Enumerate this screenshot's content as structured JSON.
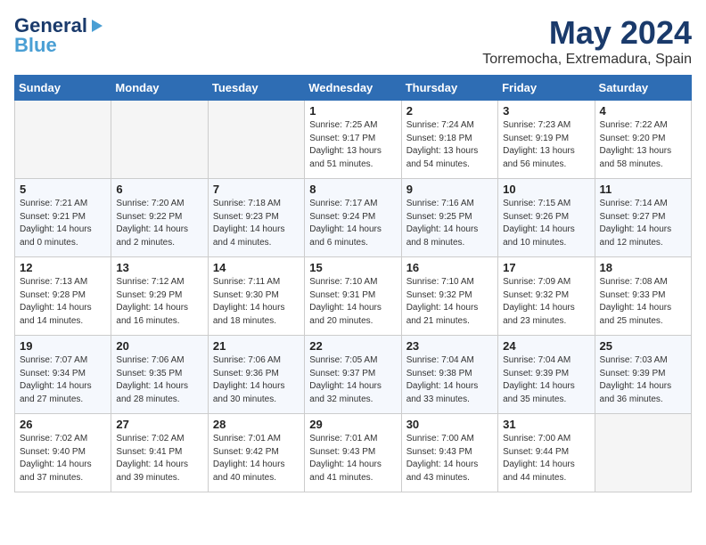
{
  "header": {
    "logo_general": "General",
    "logo_blue": "Blue",
    "month_title": "May 2024",
    "location": "Torremocha, Extremadura, Spain"
  },
  "days_of_week": [
    "Sunday",
    "Monday",
    "Tuesday",
    "Wednesday",
    "Thursday",
    "Friday",
    "Saturday"
  ],
  "weeks": [
    [
      {
        "day": "",
        "sunrise": "",
        "sunset": "",
        "daylight": "",
        "empty": true
      },
      {
        "day": "",
        "sunrise": "",
        "sunset": "",
        "daylight": "",
        "empty": true
      },
      {
        "day": "",
        "sunrise": "",
        "sunset": "",
        "daylight": "",
        "empty": true
      },
      {
        "day": "1",
        "sunrise": "Sunrise: 7:25 AM",
        "sunset": "Sunset: 9:17 PM",
        "daylight": "Daylight: 13 hours and 51 minutes.",
        "empty": false
      },
      {
        "day": "2",
        "sunrise": "Sunrise: 7:24 AM",
        "sunset": "Sunset: 9:18 PM",
        "daylight": "Daylight: 13 hours and 54 minutes.",
        "empty": false
      },
      {
        "day": "3",
        "sunrise": "Sunrise: 7:23 AM",
        "sunset": "Sunset: 9:19 PM",
        "daylight": "Daylight: 13 hours and 56 minutes.",
        "empty": false
      },
      {
        "day": "4",
        "sunrise": "Sunrise: 7:22 AM",
        "sunset": "Sunset: 9:20 PM",
        "daylight": "Daylight: 13 hours and 58 minutes.",
        "empty": false
      }
    ],
    [
      {
        "day": "5",
        "sunrise": "Sunrise: 7:21 AM",
        "sunset": "Sunset: 9:21 PM",
        "daylight": "Daylight: 14 hours and 0 minutes.",
        "empty": false
      },
      {
        "day": "6",
        "sunrise": "Sunrise: 7:20 AM",
        "sunset": "Sunset: 9:22 PM",
        "daylight": "Daylight: 14 hours and 2 minutes.",
        "empty": false
      },
      {
        "day": "7",
        "sunrise": "Sunrise: 7:18 AM",
        "sunset": "Sunset: 9:23 PM",
        "daylight": "Daylight: 14 hours and 4 minutes.",
        "empty": false
      },
      {
        "day": "8",
        "sunrise": "Sunrise: 7:17 AM",
        "sunset": "Sunset: 9:24 PM",
        "daylight": "Daylight: 14 hours and 6 minutes.",
        "empty": false
      },
      {
        "day": "9",
        "sunrise": "Sunrise: 7:16 AM",
        "sunset": "Sunset: 9:25 PM",
        "daylight": "Daylight: 14 hours and 8 minutes.",
        "empty": false
      },
      {
        "day": "10",
        "sunrise": "Sunrise: 7:15 AM",
        "sunset": "Sunset: 9:26 PM",
        "daylight": "Daylight: 14 hours and 10 minutes.",
        "empty": false
      },
      {
        "day": "11",
        "sunrise": "Sunrise: 7:14 AM",
        "sunset": "Sunset: 9:27 PM",
        "daylight": "Daylight: 14 hours and 12 minutes.",
        "empty": false
      }
    ],
    [
      {
        "day": "12",
        "sunrise": "Sunrise: 7:13 AM",
        "sunset": "Sunset: 9:28 PM",
        "daylight": "Daylight: 14 hours and 14 minutes.",
        "empty": false
      },
      {
        "day": "13",
        "sunrise": "Sunrise: 7:12 AM",
        "sunset": "Sunset: 9:29 PM",
        "daylight": "Daylight: 14 hours and 16 minutes.",
        "empty": false
      },
      {
        "day": "14",
        "sunrise": "Sunrise: 7:11 AM",
        "sunset": "Sunset: 9:30 PM",
        "daylight": "Daylight: 14 hours and 18 minutes.",
        "empty": false
      },
      {
        "day": "15",
        "sunrise": "Sunrise: 7:10 AM",
        "sunset": "Sunset: 9:31 PM",
        "daylight": "Daylight: 14 hours and 20 minutes.",
        "empty": false
      },
      {
        "day": "16",
        "sunrise": "Sunrise: 7:10 AM",
        "sunset": "Sunset: 9:32 PM",
        "daylight": "Daylight: 14 hours and 21 minutes.",
        "empty": false
      },
      {
        "day": "17",
        "sunrise": "Sunrise: 7:09 AM",
        "sunset": "Sunset: 9:32 PM",
        "daylight": "Daylight: 14 hours and 23 minutes.",
        "empty": false
      },
      {
        "day": "18",
        "sunrise": "Sunrise: 7:08 AM",
        "sunset": "Sunset: 9:33 PM",
        "daylight": "Daylight: 14 hours and 25 minutes.",
        "empty": false
      }
    ],
    [
      {
        "day": "19",
        "sunrise": "Sunrise: 7:07 AM",
        "sunset": "Sunset: 9:34 PM",
        "daylight": "Daylight: 14 hours and 27 minutes.",
        "empty": false
      },
      {
        "day": "20",
        "sunrise": "Sunrise: 7:06 AM",
        "sunset": "Sunset: 9:35 PM",
        "daylight": "Daylight: 14 hours and 28 minutes.",
        "empty": false
      },
      {
        "day": "21",
        "sunrise": "Sunrise: 7:06 AM",
        "sunset": "Sunset: 9:36 PM",
        "daylight": "Daylight: 14 hours and 30 minutes.",
        "empty": false
      },
      {
        "day": "22",
        "sunrise": "Sunrise: 7:05 AM",
        "sunset": "Sunset: 9:37 PM",
        "daylight": "Daylight: 14 hours and 32 minutes.",
        "empty": false
      },
      {
        "day": "23",
        "sunrise": "Sunrise: 7:04 AM",
        "sunset": "Sunset: 9:38 PM",
        "daylight": "Daylight: 14 hours and 33 minutes.",
        "empty": false
      },
      {
        "day": "24",
        "sunrise": "Sunrise: 7:04 AM",
        "sunset": "Sunset: 9:39 PM",
        "daylight": "Daylight: 14 hours and 35 minutes.",
        "empty": false
      },
      {
        "day": "25",
        "sunrise": "Sunrise: 7:03 AM",
        "sunset": "Sunset: 9:39 PM",
        "daylight": "Daylight: 14 hours and 36 minutes.",
        "empty": false
      }
    ],
    [
      {
        "day": "26",
        "sunrise": "Sunrise: 7:02 AM",
        "sunset": "Sunset: 9:40 PM",
        "daylight": "Daylight: 14 hours and 37 minutes.",
        "empty": false
      },
      {
        "day": "27",
        "sunrise": "Sunrise: 7:02 AM",
        "sunset": "Sunset: 9:41 PM",
        "daylight": "Daylight: 14 hours and 39 minutes.",
        "empty": false
      },
      {
        "day": "28",
        "sunrise": "Sunrise: 7:01 AM",
        "sunset": "Sunset: 9:42 PM",
        "daylight": "Daylight: 14 hours and 40 minutes.",
        "empty": false
      },
      {
        "day": "29",
        "sunrise": "Sunrise: 7:01 AM",
        "sunset": "Sunset: 9:43 PM",
        "daylight": "Daylight: 14 hours and 41 minutes.",
        "empty": false
      },
      {
        "day": "30",
        "sunrise": "Sunrise: 7:00 AM",
        "sunset": "Sunset: 9:43 PM",
        "daylight": "Daylight: 14 hours and 43 minutes.",
        "empty": false
      },
      {
        "day": "31",
        "sunrise": "Sunrise: 7:00 AM",
        "sunset": "Sunset: 9:44 PM",
        "daylight": "Daylight: 14 hours and 44 minutes.",
        "empty": false
      },
      {
        "day": "",
        "sunrise": "",
        "sunset": "",
        "daylight": "",
        "empty": true
      }
    ]
  ]
}
